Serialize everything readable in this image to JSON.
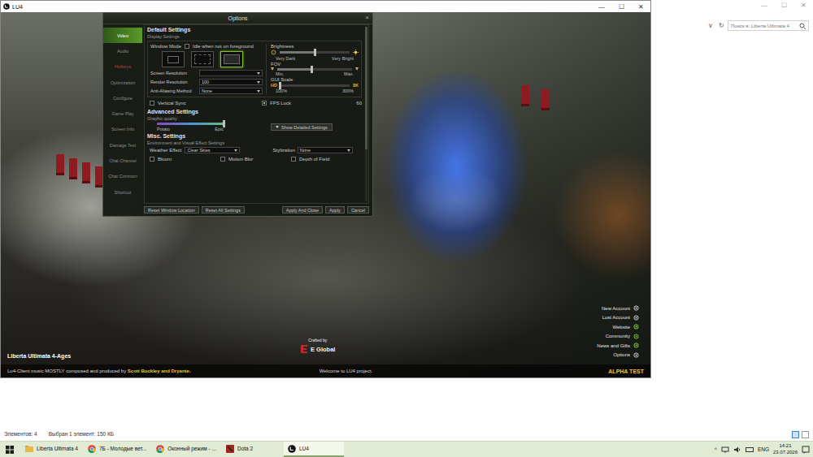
{
  "explorer": {
    "controls": [
      "—",
      "☐",
      "✕"
    ],
    "nav": [
      "∨",
      "↻"
    ],
    "search_placeholder": "Поиск в: Liberta Ultimata 4",
    "status": [
      "Элементов: 4",
      "Выбран 1 элемент: 150 КБ"
    ],
    "views": [
      {
        "selected": true
      },
      {
        "selected": false
      }
    ]
  },
  "window": {
    "title": "LU4",
    "controls": [
      "—",
      "☐",
      "✕"
    ]
  },
  "options": {
    "title": "Options",
    "close": "×",
    "tabs": [
      {
        "label": "Video",
        "selected": true,
        "disabled": false
      },
      {
        "label": "Audio",
        "selected": false,
        "disabled": false
      },
      {
        "label": "Hotkeys",
        "selected": false,
        "disabled": true
      },
      {
        "label": "Optimization",
        "selected": false,
        "disabled": false
      },
      {
        "label": "Configure",
        "selected": false,
        "disabled": false
      },
      {
        "label": "Game Play",
        "selected": false,
        "disabled": false
      },
      {
        "label": "Screen Info",
        "selected": false,
        "disabled": false
      },
      {
        "label": "Damage Text",
        "selected": false,
        "disabled": false
      },
      {
        "label": "Chat Channel",
        "selected": false,
        "disabled": false
      },
      {
        "label": "Chat Common",
        "selected": false,
        "disabled": false
      },
      {
        "label": "Shortcut",
        "selected": false,
        "disabled": false
      }
    ],
    "display": {
      "title": "Default Settings",
      "subtitle": "Display Settings",
      "window_mode": {
        "label": "Window Mode",
        "idle_label": "Idle when not on foreground",
        "idle_checked": false,
        "modes": [
          {
            "selected": false
          },
          {
            "selected": false
          },
          {
            "selected": true
          }
        ]
      },
      "dropdowns": [
        {
          "label": "Screen Resolution"
        },
        {
          "label": "Render Resolution",
          "value": "100"
        },
        {
          "label": "Anti-Aliasing Method",
          "value": "None"
        }
      ],
      "sliders": [
        {
          "kind": "brightness",
          "label": "Brightness",
          "min": "Very Dark",
          "max": "Very Bright",
          "level": 0.5
        },
        {
          "kind": "fov",
          "label": "FOV",
          "min": "Min.",
          "max": "Max.",
          "level": 0.46
        },
        {
          "kind": "scale",
          "label": "GUI Scale",
          "min_tag": "HD",
          "max_tag": "8K",
          "min": "100%",
          "max": "300%",
          "level": 0
        }
      ],
      "vsync": {
        "label": "Vertical Sync",
        "checked": false
      },
      "fps_lock": {
        "label": "FPS Lock",
        "checked": true,
        "value": "60"
      }
    },
    "advanced": {
      "title": "Advanced Settings",
      "subtitle": "Graphic quality",
      "min": "Potato",
      "max": "Epic",
      "level": 1,
      "detail_button": "Show Detailed Settings"
    },
    "misc": {
      "title": "Misc. Settings",
      "subtitle": "Environment and Visual Effect Settings",
      "selects": [
        {
          "label": "Weather Effect",
          "value": "Clear Skies"
        },
        {
          "label": "Stylization",
          "value": "None"
        }
      ],
      "checks": [
        {
          "label": "Bloom",
          "checked": false
        },
        {
          "label": "Motion Blur",
          "checked": false
        },
        {
          "label": "Depth of Field",
          "checked": false
        }
      ]
    },
    "buttons": [
      "Reset Window Location",
      "Reset All Settings",
      "Apply And Close",
      "Apply",
      "Cancel"
    ]
  },
  "launcher": {
    "game_title": "Liberta Ultimata 4-Ages",
    "credits": [
      {
        "text": "Lu4-Client music MOSTLY composed and produced by ",
        "highlight": false
      },
      {
        "text": "Scott Buckley and Dryante.",
        "highlight": true
      }
    ],
    "crafted_by": "Crafted by",
    "publisher": "E Global",
    "welcome": "Welcome to LU4 project.",
    "stage": "ALPHA TEST",
    "menu": [
      {
        "label": "New Account",
        "color": "#d8d8d8"
      },
      {
        "label": "Lost Account",
        "color": "#d8d8d8"
      },
      {
        "label": "Website",
        "color": "#8fd14f"
      },
      {
        "label": "Community",
        "color": "#7fc24a"
      },
      {
        "label": "News and Gifts",
        "color": "#8fd14f"
      },
      {
        "label": "Options",
        "color": "#d8d8d8"
      }
    ]
  },
  "taskbar": {
    "apps": [
      {
        "label": "Liberta Ultimata 4",
        "kind": "folder",
        "selected": false
      },
      {
        "label": "7Б - Молодые вет...",
        "kind": "chrome",
        "selected": false
      },
      {
        "label": "Оконный режим - ...",
        "kind": "chrome",
        "selected": false
      },
      {
        "label": "Dota 2",
        "kind": "dota",
        "selected": false
      },
      {
        "label": "LU4",
        "kind": "lu4",
        "selected": true
      }
    ],
    "tray_arrow": "^",
    "lang": "ENG",
    "time": "14:21",
    "date": "23.07.2026"
  }
}
